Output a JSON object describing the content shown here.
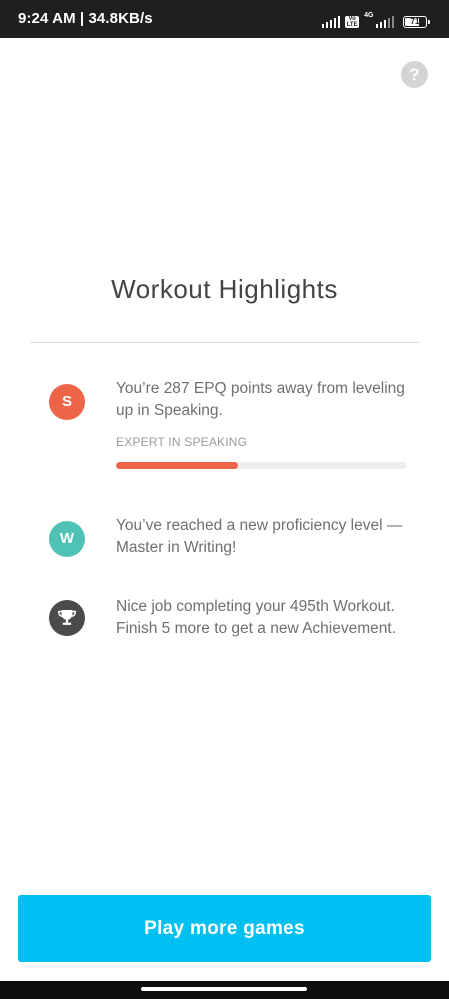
{
  "status_bar": {
    "time_speed": "9:24 AM | 34.8KB/s",
    "volte_badge": "Vo LTE",
    "network": "4G",
    "battery_level": "71",
    "battery_fraction": 0.71
  },
  "help": {
    "icon": "help-icon",
    "glyph": "?"
  },
  "title": "Workout Highlights",
  "highlights": [
    {
      "icon_letter": "S",
      "icon_color": "#ee6447",
      "text": "You’re 287 EPQ points away from leveling up in Speaking.",
      "skill_label": "EXPERT IN SPEAKING",
      "progress_fraction": 0.42,
      "progress_color": "#ee6447"
    },
    {
      "icon_letter": "W",
      "icon_color": "#4ec2b4",
      "text": "You’ve reached a new proficiency level —Master in Writing!"
    },
    {
      "icon": "trophy-icon",
      "icon_color": "#4b4b4b",
      "text": "Nice job completing your 495th Workout. Finish 5 more to get a new Achievement."
    }
  ],
  "cta": {
    "label": "Play more games",
    "color": "#00c0f1"
  }
}
